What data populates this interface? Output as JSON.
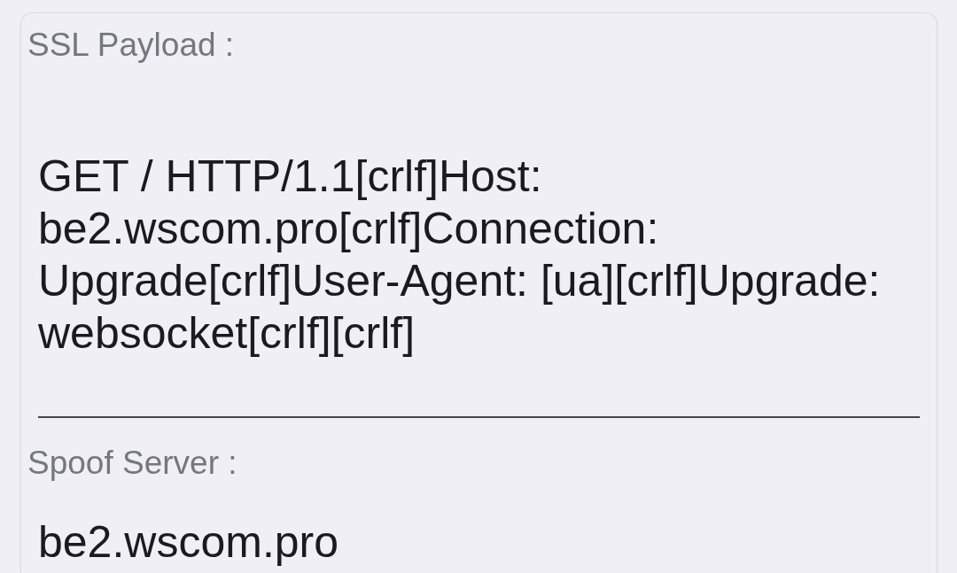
{
  "fields": [
    {
      "label": "SSL Payload :",
      "value": "GET / HTTP/1.1[crlf]Host: be2.wscom.pro[crlf]Connection: Upgrade[crlf]User-Agent: [ua][crlf]Upgrade: websocket[crlf][crlf]"
    },
    {
      "label": "Spoof Server :",
      "value": "be2.wscom.pro"
    }
  ]
}
